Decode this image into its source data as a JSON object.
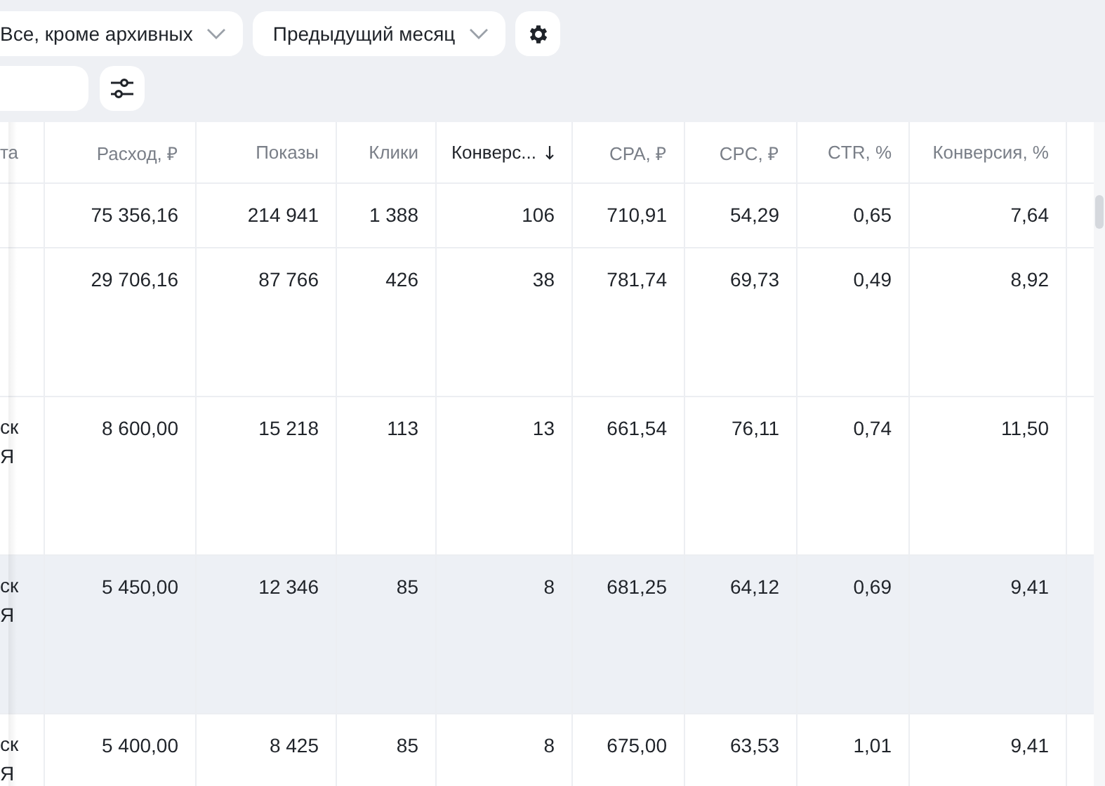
{
  "filters": [
    {
      "kind": "dropdown",
      "label": "Все, кроме архивных"
    },
    {
      "kind": "dropdown",
      "label": "Предыдущий месяц"
    },
    {
      "kind": "settings"
    }
  ],
  "table": {
    "columns": [
      {
        "label": "та",
        "sorted": false
      },
      {
        "label": "Расход, ₽",
        "sorted": false
      },
      {
        "label": "Показы",
        "sorted": false
      },
      {
        "label": "Клики",
        "sorted": false
      },
      {
        "label": "Конверс...",
        "sorted": true
      },
      {
        "label": "CPA, ₽",
        "sorted": false
      },
      {
        "label": "CPC, ₽",
        "sorted": false
      },
      {
        "label": "CTR, %",
        "sorted": false
      },
      {
        "label": "Конверсия, %",
        "sorted": false
      }
    ],
    "rows": [
      {
        "hovered": false,
        "cells": [
          "",
          "75 356,16",
          "214 941",
          "1 388",
          "106",
          "710,91",
          "54,29",
          "0,65",
          "7,64"
        ]
      },
      {
        "hovered": false,
        "cells": [
          "",
          "29 706,16",
          "87 766",
          "426",
          "38",
          "781,74",
          "69,73",
          "0,49",
          "8,92"
        ]
      },
      {
        "hovered": false,
        "cells": [
          "ск Я",
          "8 600,00",
          "15 218",
          "113",
          "13",
          "661,54",
          "76,11",
          "0,74",
          "11,50"
        ]
      },
      {
        "hovered": true,
        "cells": [
          "ск Я",
          "5 450,00",
          "12 346",
          "85",
          "8",
          "681,25",
          "64,12",
          "0,69",
          "9,41"
        ]
      },
      {
        "hovered": false,
        "cells": [
          "ск Я",
          "5 400,00",
          "8 425",
          "85",
          "8",
          "675,00",
          "63,53",
          "1,01",
          "9,41"
        ]
      }
    ]
  }
}
